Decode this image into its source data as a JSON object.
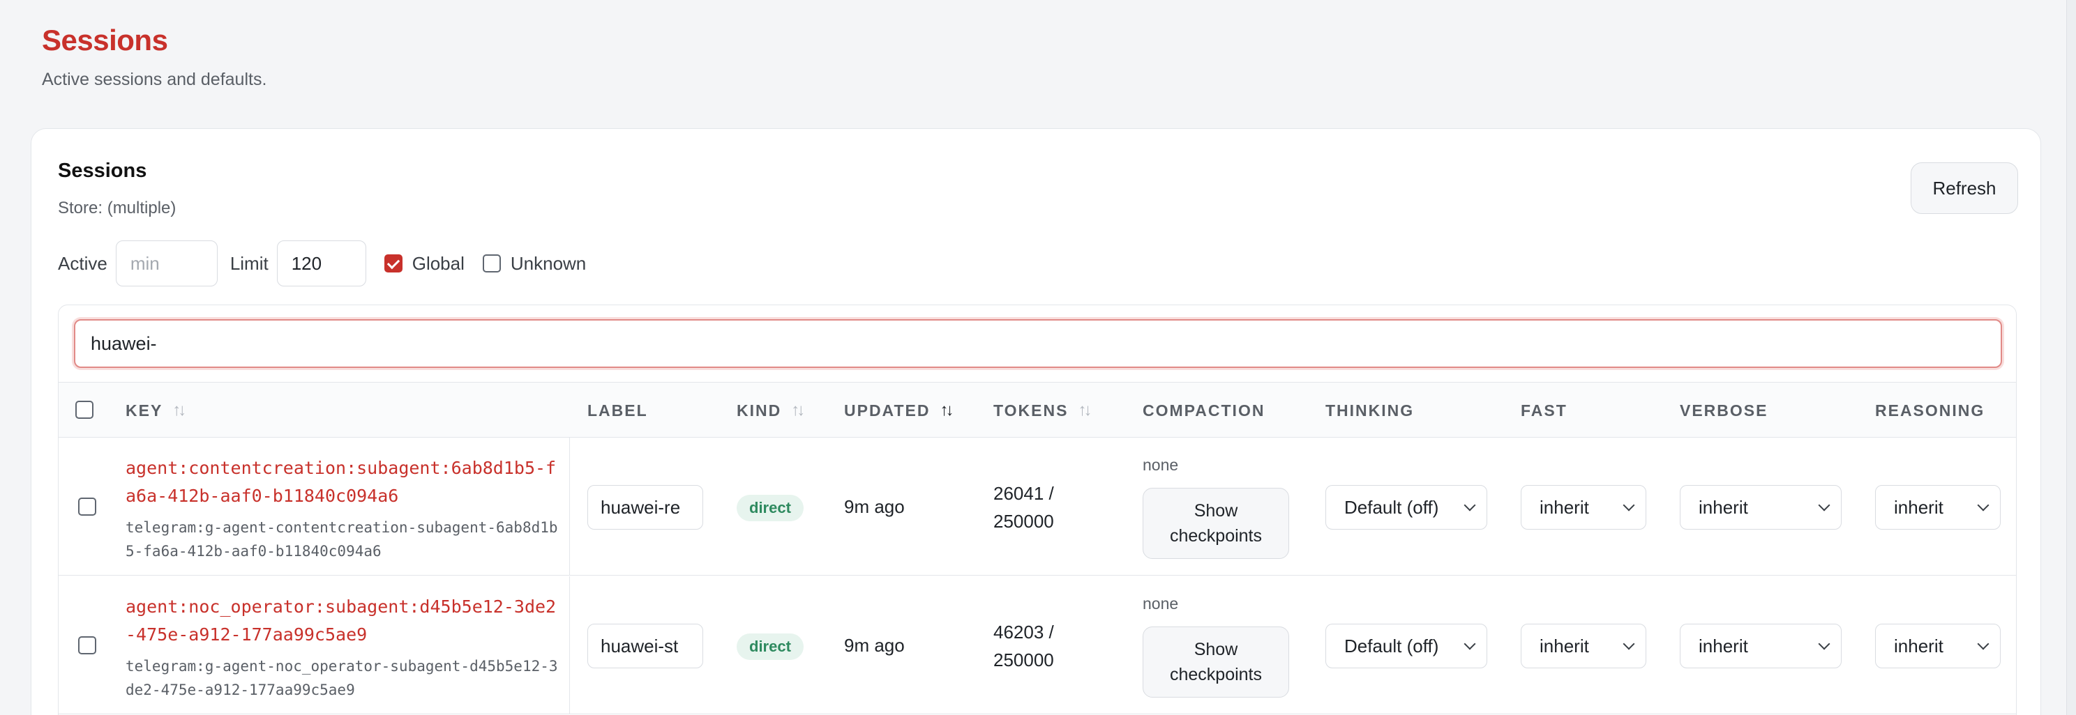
{
  "page": {
    "title": "Sessions",
    "subtitle": "Active sessions and defaults."
  },
  "card": {
    "title": "Sessions",
    "store": "Store: (multiple)",
    "refresh_label": "Refresh"
  },
  "filters": {
    "active_label": "Active",
    "active_placeholder": "min",
    "limit_label": "Limit",
    "limit_value": "120",
    "global_label": "Global",
    "global_checked": true,
    "unknown_label": "Unknown",
    "unknown_checked": false
  },
  "search": {
    "value": "huawei-"
  },
  "columns": {
    "key": "KEY",
    "label": "LABEL",
    "kind": "KIND",
    "updated": "UPDATED",
    "tokens": "TOKENS",
    "compaction": "COMPACTION",
    "thinking": "THINKING",
    "fast": "FAST",
    "verbose": "VERBOSE",
    "reasoning": "REASONING"
  },
  "rows": [
    {
      "key": "agent:contentcreation:subagent:6ab8d1b5-fa6a-412b-aaf0-b11840c094a6",
      "key_sub": "telegram:g-agent-contentcreation-subagent-6ab8d1b5-fa6a-412b-aaf0-b11840c094a6",
      "label": "huawei-re",
      "kind": "direct",
      "updated": "9m ago",
      "tokens_line1": "26041 /",
      "tokens_line2": "250000",
      "compaction": "none",
      "checkpoints_line1": "Show",
      "checkpoints_line2": "checkpoints",
      "thinking": "Default (off)",
      "fast": "inherit",
      "verbose": "inherit",
      "reasoning": "inherit"
    },
    {
      "key": "agent:noc_operator:subagent:d45b5e12-3de2-475e-a912-177aa99c5ae9",
      "key_sub": "telegram:g-agent-noc_operator-subagent-d45b5e12-3de2-475e-a912-177aa99c5ae9",
      "label": "huawei-st",
      "kind": "direct",
      "updated": "9m ago",
      "tokens_line1": "46203 /",
      "tokens_line2": "250000",
      "compaction": "none",
      "checkpoints_line1": "Show",
      "checkpoints_line2": "checkpoints",
      "thinking": "Default (off)",
      "fast": "inherit",
      "verbose": "inherit",
      "reasoning": "inherit"
    }
  ],
  "icons": {
    "sort": "sort-icon",
    "chevron": "chevron-down-icon",
    "checkbox": "checkbox-icon"
  },
  "colors": {
    "accent": "#c8312b",
    "badge_bg": "#e7f4ee",
    "badge_text": "#2e8a5f"
  }
}
